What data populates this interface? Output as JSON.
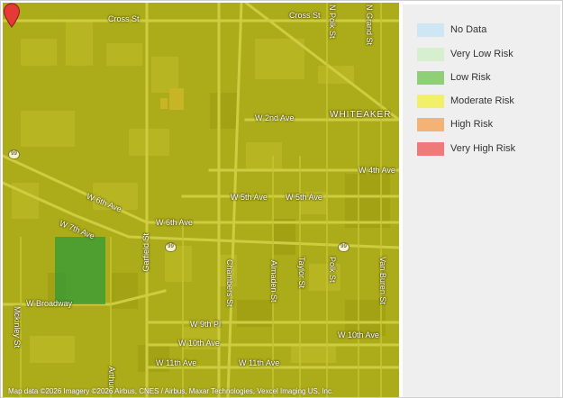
{
  "map": {
    "streets": {
      "cross_st_1": "Cross St",
      "cross_st_2": "Cross St",
      "n_polk": "N Polk St",
      "n_grand": "N Grand St",
      "w_2nd": "W 2nd Ave",
      "whiteaker": "WHITEAKER",
      "w_4th": "W 4th Ave",
      "w_5th_1": "W 5th Ave",
      "w_5th_2": "W 5th Ave",
      "w_6th_1": "W 6th Ave",
      "w_6th_2": "W 6th Ave",
      "w_7th": "W 7th Ave",
      "garfield": "Garfield St",
      "chambers": "Chambers St",
      "almaden": "Almaden St",
      "taylor": "Taylor St",
      "polk": "Polk St",
      "van_buren": "Van Buren St",
      "w_broadway": "W Broadway",
      "mckinley": "Mckinley St",
      "w_9th": "W 9th Pl",
      "w_10th_1": "W 10th Ave",
      "w_10th_2": "W 10th Ave",
      "w_11th_1": "W 11th Ave",
      "w_11th_2": "W 11th Ave",
      "arthur": "Arthur"
    },
    "shields": {
      "s1": "99",
      "s2": "99",
      "s3": "99"
    },
    "attribution": "Map data ©2026 Imagery ©2026 Airbus, CNES / Airbus, Maxar Technologies, Vexcel Imaging US, Inc.",
    "highlight_zone_risk": "Low Risk",
    "base_zone_risk": "Moderate Risk"
  },
  "legend": {
    "items": [
      {
        "label": "No Data",
        "color": "#cfe6f5"
      },
      {
        "label": "Very Low Risk",
        "color": "#d5efcf"
      },
      {
        "label": "Low Risk",
        "color": "#8fcf78"
      },
      {
        "label": "Moderate Risk",
        "color": "#f2ef6a"
      },
      {
        "label": "High Risk",
        "color": "#f4b274"
      },
      {
        "label": "Very High Risk",
        "color": "#f07a7a"
      }
    ]
  },
  "colors": {
    "map_tint": "#c8c614",
    "low_risk_overlay": "#2f9a38",
    "pin": "#e53935"
  }
}
